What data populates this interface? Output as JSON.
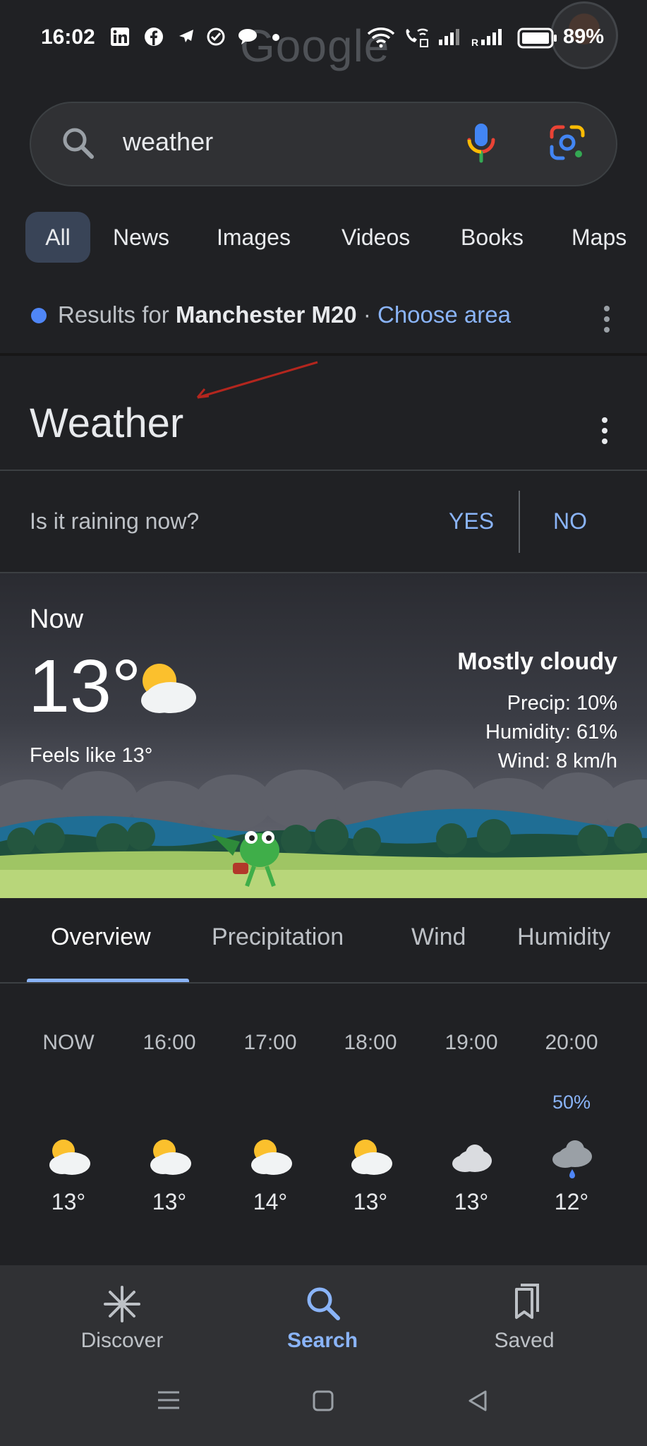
{
  "status_bar": {
    "time": "16:02",
    "battery": "89%",
    "watermark": "Google",
    "icons": [
      "linkedin-icon",
      "facebook-icon",
      "airplane-icon",
      "check-circle-icon",
      "chat-bubble-icon",
      "dot-icon",
      "wifi-icon",
      "wifi-calling-icon",
      "signal-icon",
      "roaming-signal-icon",
      "battery-icon"
    ],
    "roaming_label": "R"
  },
  "search": {
    "query": "weather"
  },
  "tabs": [
    {
      "label": "All",
      "active": true
    },
    {
      "label": "News"
    },
    {
      "label": "Images"
    },
    {
      "label": "Videos"
    },
    {
      "label": "Books"
    },
    {
      "label": "Maps"
    }
  ],
  "location": {
    "prefix": "Results for ",
    "place": "Manchester M20",
    "separator": " · ",
    "choose": "Choose area"
  },
  "weather": {
    "title": "Weather",
    "question": "Is it raining now?",
    "yes": "YES",
    "no": "NO",
    "now_label": "Now",
    "temperature": "13°",
    "feels_like": "Feels like 13°",
    "condition": "Mostly cloudy",
    "precip": "Precip: 10%",
    "humidity": "Humidity: 61%",
    "wind": "Wind: 8 km/h",
    "forecast_tabs": [
      "Overview",
      "Precipitation",
      "Wind",
      "Humidity"
    ],
    "hourly": [
      {
        "time": "NOW",
        "pct": "",
        "icon": "partly-cloudy-icon",
        "temp": "13°"
      },
      {
        "time": "16:00",
        "pct": "",
        "icon": "partly-cloudy-icon",
        "temp": "13°"
      },
      {
        "time": "17:00",
        "pct": "",
        "icon": "partly-cloudy-icon",
        "temp": "14°"
      },
      {
        "time": "18:00",
        "pct": "",
        "icon": "partly-cloudy-icon",
        "temp": "13°"
      },
      {
        "time": "19:00",
        "pct": "",
        "icon": "cloud-icon",
        "temp": "13°"
      },
      {
        "time": "20:00",
        "pct": "50%",
        "icon": "rain-cloud-icon",
        "temp": "12°"
      }
    ]
  },
  "bottom_nav": {
    "discover": "Discover",
    "search": "Search",
    "saved": "Saved"
  },
  "colors": {
    "accent": "#8ab4f8",
    "background": "#202124",
    "surface": "#303134"
  }
}
